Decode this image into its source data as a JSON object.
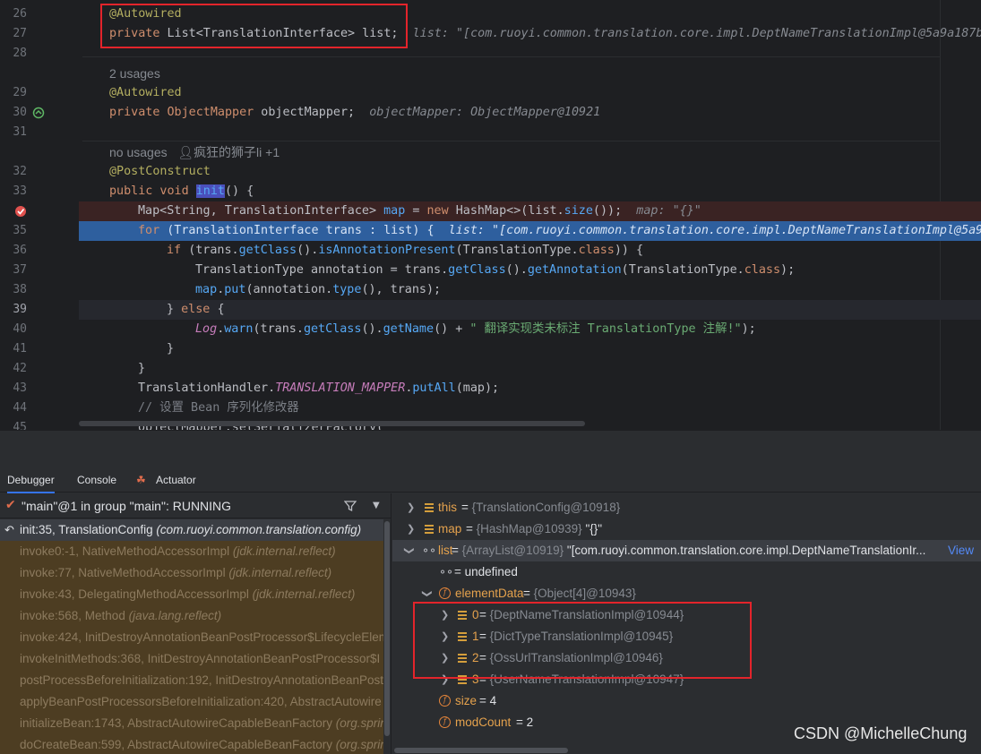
{
  "editor": {
    "lines": [
      {
        "num": "26"
      },
      {
        "num": "27"
      },
      {
        "num": "28"
      },
      {
        "num": "29"
      },
      {
        "num": "30"
      },
      {
        "num": "31"
      },
      {
        "num": "32"
      },
      {
        "num": "33"
      },
      {
        "num": "34"
      },
      {
        "num": "35"
      },
      {
        "num": "36"
      },
      {
        "num": "37"
      },
      {
        "num": "38"
      },
      {
        "num": "39"
      },
      {
        "num": "40"
      },
      {
        "num": "41"
      },
      {
        "num": "42"
      },
      {
        "num": "43"
      },
      {
        "num": "44"
      },
      {
        "num": "45"
      }
    ],
    "hints": {
      "usages_2": "2 usages",
      "no_usages": "no usages",
      "author": "疯狂的狮子li +1"
    },
    "code": {
      "l26": "@Autowired",
      "l27_kw": "private ",
      "l27_type": "List<TranslationInterface> list;",
      "l27_inlay": "list: \"[com.ruoyi.common.translation.core.impl.DeptNameTranslationImpl@5a9a187b",
      "l29": "@Autowired",
      "l30_kw": "private ",
      "l30_type": "ObjectMapper",
      "l30_rest": " objectMapper;",
      "l30_inlay": "objectMapper: ObjectMapper@10921",
      "l32": "@PostConstruct",
      "l33_kw": "public void ",
      "l33_fn": "init",
      "l33_rest": "() {",
      "l34_a": "Map<String, TranslationInterface> ",
      "l34_var": "map",
      "l34_b": " = ",
      "l34_new": "new ",
      "l34_c": "HashMap<>(list.",
      "l34_fn": "size",
      "l34_d": "());",
      "l34_inlay": "map: \"{}\"",
      "l35_kw": "for ",
      "l35_a": "(TranslationInterface trans : list) {",
      "l35_inlay": "list: \"[com.ruoyi.common.translation.core.impl.DeptNameTranslationImpl@5a9",
      "l36_kw": "if ",
      "l36_a": "(trans.",
      "l36_fn1": "getClass",
      "l36_b": "().",
      "l36_fn2": "isAnnotationPresent",
      "l36_c": "(TranslationType.",
      "l36_kw2": "class",
      "l36_d": ")) {",
      "l37_a": "TranslationType annotation = trans.",
      "l37_fn1": "getClass",
      "l37_b": "().",
      "l37_fn2": "getAnnotation",
      "l37_c": "(TranslationType.",
      "l37_kw2": "class",
      "l37_d": ");",
      "l38_var": "map",
      "l38_a": ".",
      "l38_fn1": "put",
      "l38_b": "(annotation.",
      "l38_fn2": "type",
      "l38_c": "(), trans);",
      "l39_a": "} ",
      "l39_kw": "else ",
      "l39_b": "{",
      "l40_log": "Log",
      "l40_a": ".",
      "l40_fn1": "warn",
      "l40_b": "(trans.",
      "l40_fn2": "getClass",
      "l40_c": "().",
      "l40_fn3": "getName",
      "l40_d": "() + ",
      "l40_str": "\" 翻译实现类未标注 TranslationType 注解!\"",
      "l40_e": ");",
      "l41": "}",
      "l42": "}",
      "l43_a": "TranslationHandler.",
      "l43_const": "TRANSLATION_MAPPER",
      "l43_b": ".",
      "l43_fn": "putAll",
      "l43_c": "(map);",
      "l44": "// 设置 Bean 序列化修改器",
      "l45": "objectMapper.setSerializerFactory("
    }
  },
  "panel": {
    "tabs": [
      "Debugger",
      "Console",
      "Actuator"
    ],
    "thread": "\"main\"@1 in group \"main\": RUNNING",
    "frames": [
      {
        "method": "init:35, TranslationConfig ",
        "cls": "(com.ruoyi.common.translation.config)"
      },
      {
        "method": "invoke0:-1, NativeMethodAccessorImpl ",
        "cls": "(jdk.internal.reflect)"
      },
      {
        "method": "invoke:77, NativeMethodAccessorImpl ",
        "cls": "(jdk.internal.reflect)"
      },
      {
        "method": "invoke:43, DelegatingMethodAccessorImpl ",
        "cls": "(jdk.internal.reflect)"
      },
      {
        "method": "invoke:568, Method ",
        "cls": "(java.lang.reflect)"
      },
      {
        "method": "invoke:424, InitDestroyAnnotationBeanPostProcessor$LifecycleElem",
        "cls": ""
      },
      {
        "method": "invokeInitMethods:368, InitDestroyAnnotationBeanPostProcessor$I",
        "cls": ""
      },
      {
        "method": "postProcessBeforeInitialization:192, InitDestroyAnnotationBeanPost",
        "cls": ""
      },
      {
        "method": "applyBeanPostProcessorsBeforeInitialization:420, AbstractAutowire",
        "cls": ""
      },
      {
        "method": "initializeBean:1743, AbstractAutowireCapableBeanFactory ",
        "cls": "(org.sprin"
      },
      {
        "method": "doCreateBean:599, AbstractAutowireCapableBeanFactory ",
        "cls": "(org.sprin"
      }
    ],
    "vars": {
      "this": {
        "name": "this",
        "eq": " = ",
        "type": "{TranslationConfig@10918}"
      },
      "map": {
        "name": "map",
        "eq": " = ",
        "type": "{HashMap@10939} ",
        "val": "\"{}\""
      },
      "list": {
        "name": "list",
        "eq": " = ",
        "type": "{ArrayList@10919} ",
        "val": "\"[com.ruoyi.common.translation.core.impl.DeptNameTranslationIr...",
        "link": "View"
      },
      "undef": {
        "name": " = undefined"
      },
      "elementData": {
        "name": "elementData",
        "eq": " = ",
        "type": "{Object[4]@10943}"
      },
      "items": [
        {
          "name": "0",
          "eq": " = ",
          "type": "{DeptNameTranslationImpl@10944}"
        },
        {
          "name": "1",
          "eq": " = ",
          "type": "{DictTypeTranslationImpl@10945}"
        },
        {
          "name": "2",
          "eq": " = ",
          "type": "{OssUrlTranslationImpl@10946}"
        },
        {
          "name": "3",
          "eq": " = ",
          "type": "{UserNameTranslationImpl@10947}"
        }
      ],
      "size": {
        "name": "size",
        "eq": " = ",
        "val": "4"
      },
      "modCount": {
        "name": "modCount",
        "eq": " = ",
        "val": "2"
      }
    }
  },
  "watermark": "CSDN @MichelleChung",
  "colors": {
    "breakpoint": "#e0514e",
    "exec_line": "#2e5f9e",
    "highlight_box": "#e3242b"
  }
}
